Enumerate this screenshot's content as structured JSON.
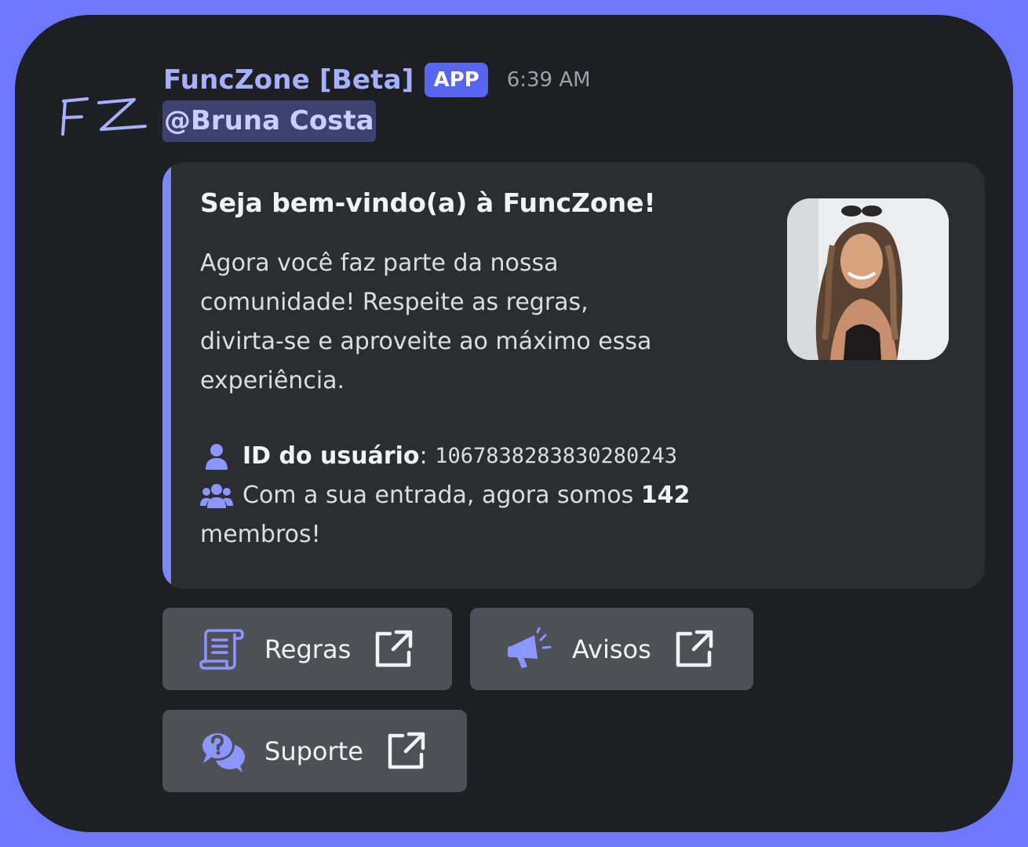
{
  "message": {
    "bot_name": "FuncZone [Beta]",
    "badge": "APP",
    "timestamp": "6:39 AM",
    "mention": "@Bruna Costa",
    "logo_text": "FZ"
  },
  "embed": {
    "accent_color": "#7b87ff",
    "title": "Seja bem-vindo(a) à FuncZone!",
    "description_lines": [
      "Agora você faz parte da nossa",
      "comunidade! Respeite as regras,",
      "divirta-se e aproveite ao máximo essa",
      "experiência."
    ],
    "user_id_label": "ID do usuário",
    "user_id_sep": ":",
    "user_id_value": "1067838283830280243",
    "members_prefix": "Com a sua entrada, agora somos",
    "members_count": "142",
    "members_suffix": "membros!",
    "user_icon": "user-icon",
    "members_icon": "users-icon"
  },
  "buttons": [
    {
      "label": "Regras",
      "icon": "scroll-icon"
    },
    {
      "label": "Avisos",
      "icon": "megaphone-icon"
    },
    {
      "label": "Suporte",
      "icon": "question-chat-icon"
    }
  ],
  "colors": {
    "background": "#6b78ff",
    "card": "#1e1f22",
    "button": "#4e5058",
    "brand": "#5865f2",
    "icon_accent": "#8c96ff"
  }
}
